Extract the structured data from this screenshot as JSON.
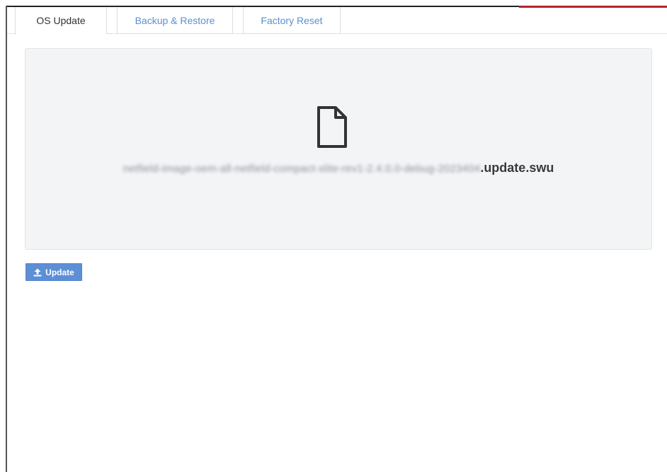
{
  "tabs": [
    {
      "label": "OS Update",
      "active": true
    },
    {
      "label": "Backup & Restore",
      "active": false
    },
    {
      "label": "Factory Reset",
      "active": false
    }
  ],
  "upload": {
    "file_icon": "file-icon",
    "filename_obscured": "netfield-image-oem-all-netfield-compact-xlite-rev1-2.4.0.0-debug-2023404",
    "filename_suffix": ".update.swu"
  },
  "actions": {
    "update_label": "Update",
    "update_icon": "upload-icon"
  },
  "colors": {
    "accent": "#5d8fd6",
    "top_accent": "#b3222a",
    "dropzone_bg": "#f3f4f6"
  }
}
